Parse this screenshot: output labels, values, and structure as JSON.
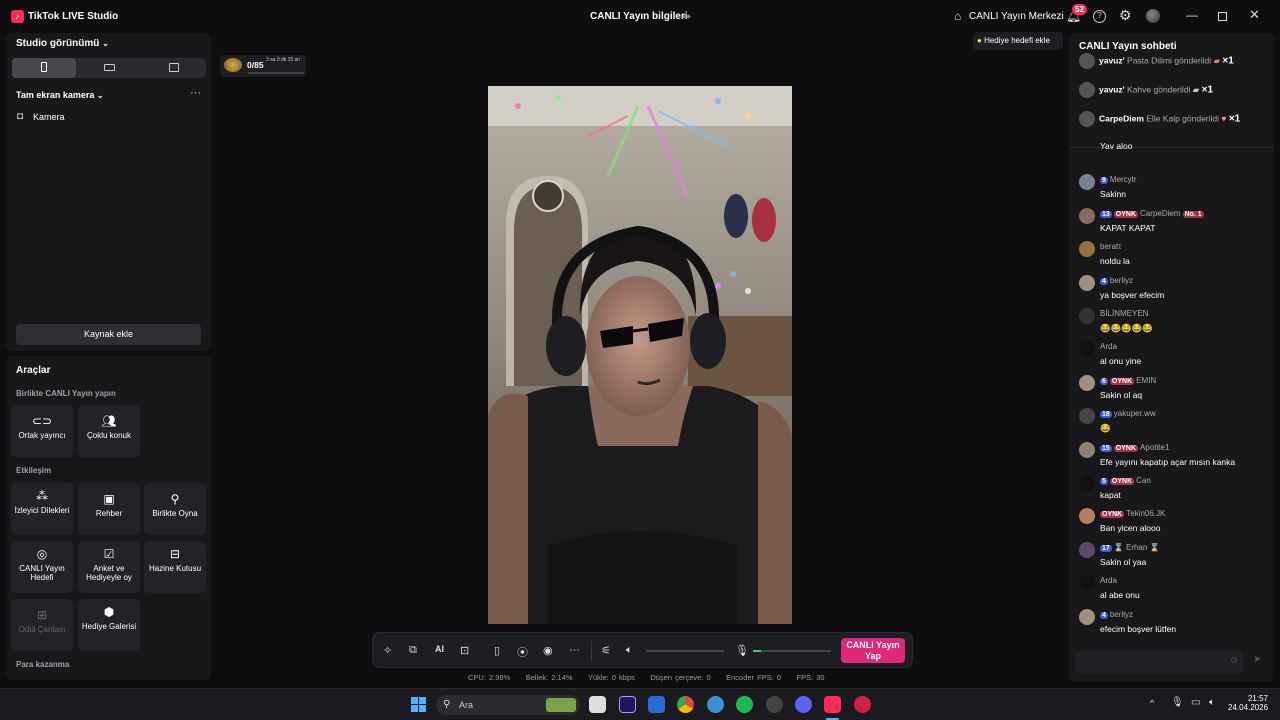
{
  "titlebar": {
    "app_name": "TikTok LIVE Studio",
    "center_title": "CANLI Yayın bilgileri",
    "live_center": "CANLI Yayın Merkezi",
    "notification_count": "52"
  },
  "studio": {
    "view_label": "Studio görünümü",
    "scene_label": "Tam ekran kamera",
    "source_label": "Kamera",
    "add_source": "Kaynak ekle"
  },
  "tools": {
    "title": "Araçlar",
    "section_collab": "Birlikte CANLI Yayın yapın",
    "cohost": "Ortak yayıncı",
    "multi_guest": "Çoklu konuk",
    "section_engage": "Etkileşim",
    "viewer_wishes": "İzleyici Dilekleri",
    "guide": "Rehber",
    "play_together": "Birlikte Oyna",
    "live_goal": "CANLI Yayın Hedefi",
    "poll": "Anket ve Hediyeyle oy",
    "treasure": "Hazine Kutusu",
    "reward_bag": "Ödül Çantası",
    "gift_gallery": "Hediye Galerisi",
    "section_earn": "Para kazanma"
  },
  "goal": {
    "count": "0/85",
    "timer": "3 sa 0 dk 15 sn"
  },
  "gift_goal_button": "Hediye hedefi ekle",
  "controls": {
    "go_live": "CANLI Yayın Yap",
    "mic_level": 0.1,
    "volume_level": 0.0
  },
  "stats": {
    "cpu": "CPU: 2.98%",
    "memory": "Bellek: 2.14%",
    "upload": "Yükle: 0 kbps",
    "dropped": "Düşen çerçeve: 0",
    "encoder": "Encoder FPS: 0",
    "fps": "FPS: 30"
  },
  "chat": {
    "title": "CANLI Yayın sohbeti",
    "gifts": [
      {
        "name": "yavuz'",
        "text": "Pasta Dilimi gönderildi",
        "count": "×1"
      },
      {
        "name": "yavuz'",
        "text": "Kahve gönderildi",
        "count": "×1"
      },
      {
        "name": "CarpeDiem",
        "text": "Elle Kalp gönderildi",
        "count": "×1"
      }
    ],
    "messages": [
      {
        "level": "",
        "badge": "",
        "user": "",
        "text": "Yav aloo"
      },
      {
        "level": "9",
        "badge": "",
        "user": "Mercytr",
        "text": "Sakinn"
      },
      {
        "level": "13",
        "badge": "OYNK",
        "user": "CarpeDiem",
        "extra": "No. 1",
        "text": "KAPAT KAPAT"
      },
      {
        "level": "",
        "badge": "",
        "user": "beratτ",
        "text": "noldu la"
      },
      {
        "level": "4",
        "badge": "",
        "user": "berliyz",
        "text": "ya boşver efecim"
      },
      {
        "level": "",
        "badge": "",
        "user": "BİLİNMEYEN",
        "text": "😂😂😂😂😂"
      },
      {
        "level": "",
        "badge": "",
        "user": "Arda",
        "text": "al onu yine"
      },
      {
        "level": "6",
        "badge": "OYNK",
        "user": "EMIN",
        "text": "Sakin ol aq"
      },
      {
        "level": "18",
        "badge": "",
        "user": "yakuper.ww",
        "text": "😂"
      },
      {
        "level": "15",
        "badge": "OYNK",
        "user": "Apotite1",
        "text": "Efe yayını kapatıp açar mısın kanka"
      },
      {
        "level": "5",
        "badge": "OYNK",
        "user": "Can",
        "text": "kapat"
      },
      {
        "level": "",
        "badge": "OYNK",
        "user": "Tekin06.JK",
        "text": "Ban yicen alooo"
      },
      {
        "level": "17",
        "badge": "",
        "user": "⌛ Erhan ⌛",
        "text": "Sakin ol yaa"
      },
      {
        "level": "",
        "badge": "",
        "user": "Arda",
        "text": "al abe onu"
      },
      {
        "level": "4",
        "badge": "",
        "user": "berliyz",
        "text": "efecim boşver lütfen"
      }
    ]
  },
  "taskbar": {
    "search": "Ara",
    "time": "21:57",
    "date": "24.04.2026"
  },
  "colors": {
    "accent": "#fe2c55",
    "live_button": "#e0287a",
    "level_badge": "#3b5bdb"
  }
}
